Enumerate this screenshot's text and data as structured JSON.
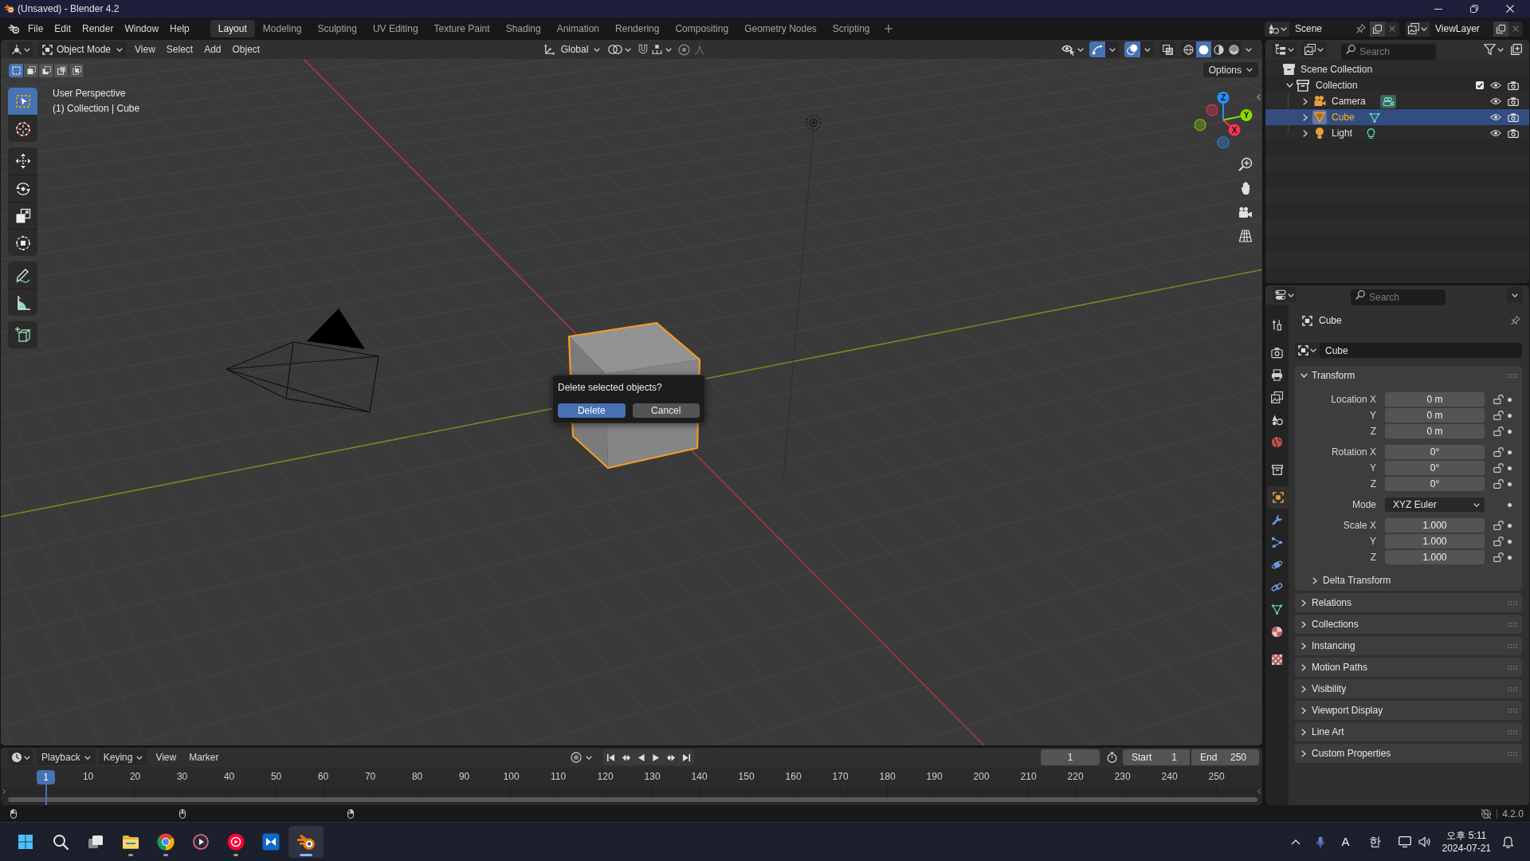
{
  "window": {
    "title": "(Unsaved) - Blender 4.2"
  },
  "menu": [
    "File",
    "Edit",
    "Render",
    "Window",
    "Help"
  ],
  "workspace_tabs": [
    {
      "label": "Layout",
      "selected": true
    },
    {
      "label": "Modeling",
      "selected": false
    },
    {
      "label": "Sculpting",
      "selected": false
    },
    {
      "label": "UV Editing",
      "selected": false
    },
    {
      "label": "Texture Paint",
      "selected": false
    },
    {
      "label": "Shading",
      "selected": false
    },
    {
      "label": "Animation",
      "selected": false
    },
    {
      "label": "Rendering",
      "selected": false
    },
    {
      "label": "Compositing",
      "selected": false
    },
    {
      "label": "Geometry Nodes",
      "selected": false
    },
    {
      "label": "Scripting",
      "selected": false
    }
  ],
  "scene_selector": {
    "value": "Scene"
  },
  "view_layer_selector": {
    "value": "ViewLayer"
  },
  "viewport": {
    "mode": "Object Mode",
    "menus": [
      "View",
      "Select",
      "Add",
      "Object"
    ],
    "orientation": "Global",
    "gizmos_on": true,
    "overlays_on": true,
    "xray_on": false,
    "shading_modes": [
      {
        "kind": "wireframe",
        "selected": false
      },
      {
        "kind": "solid",
        "selected": true
      },
      {
        "kind": "material",
        "selected": false
      },
      {
        "kind": "rendered",
        "selected": false
      }
    ],
    "select_modes": [
      {
        "kind": "set",
        "selected": true
      },
      {
        "kind": "extend",
        "selected": false
      },
      {
        "kind": "subtract",
        "selected": false
      },
      {
        "kind": "invert",
        "selected": false
      },
      {
        "kind": "intersect",
        "selected": false
      }
    ],
    "options": "Options",
    "info": [
      "User Perspective",
      "(1) Collection | Cube"
    ],
    "tool_groups": [
      [
        {
          "kind": "select_box",
          "selected": true
        },
        {
          "kind": "cursor",
          "selected": false
        }
      ],
      [
        {
          "kind": "move",
          "selected": false
        },
        {
          "kind": "rotate",
          "selected": false
        },
        {
          "kind": "scale",
          "selected": false
        },
        {
          "kind": "transform",
          "selected": false
        }
      ],
      [
        {
          "kind": "annotate",
          "selected": false
        },
        {
          "kind": "measure",
          "selected": false
        }
      ],
      [
        {
          "kind": "add_cube",
          "selected": false
        }
      ]
    ],
    "gizmo_axes": [
      {
        "label": "X",
        "color": "#ff3352"
      },
      {
        "label": "Y",
        "color": "#8bdc00"
      },
      {
        "label": "Z",
        "color": "#2890ff"
      }
    ],
    "dialog": {
      "message": "Delete selected objects?",
      "buttons": [
        {
          "label": "Delete",
          "selected": true
        },
        {
          "label": "Cancel",
          "selected": false
        }
      ]
    }
  },
  "outliner": {
    "search_placeholder": "Search",
    "root": "Scene Collection",
    "collections": [
      {
        "label": "Collection",
        "expanded": true,
        "checked": true,
        "children": [
          {
            "label": "Camera",
            "kind": "camera",
            "selected": false,
            "expanded": false
          },
          {
            "label": "Cube",
            "kind": "mesh",
            "selected": true,
            "expanded": false
          },
          {
            "label": "Light",
            "kind": "light",
            "selected": false,
            "expanded": false
          }
        ]
      }
    ]
  },
  "properties": {
    "search_placeholder": "Search",
    "tab_groups": [
      [
        {
          "kind": "tool",
          "selected": false
        }
      ],
      [
        {
          "kind": "render",
          "selected": false
        },
        {
          "kind": "output",
          "selected": false
        },
        {
          "kind": "view_layer",
          "selected": false
        },
        {
          "kind": "scene",
          "selected": false
        },
        {
          "kind": "world",
          "selected": false
        }
      ],
      [
        {
          "kind": "collection",
          "selected": false
        }
      ],
      [
        {
          "kind": "object",
          "selected": true
        },
        {
          "kind": "modifiers",
          "selected": false
        },
        {
          "kind": "particles",
          "selected": false
        },
        {
          "kind": "physics",
          "selected": false
        },
        {
          "kind": "constraints",
          "selected": false
        },
        {
          "kind": "data",
          "selected": false
        },
        {
          "kind": "material",
          "selected": false
        }
      ],
      [
        {
          "kind": "texture",
          "selected": false
        }
      ]
    ],
    "object_name": "Cube",
    "datablock": "Cube",
    "transform": {
      "label": "Transform",
      "expanded": true,
      "groups": [
        [
          {
            "label": "Location X",
            "kind": "number",
            "value": "0 m"
          },
          {
            "label": "Y",
            "kind": "number",
            "value": "0 m"
          },
          {
            "label": "Z",
            "kind": "number",
            "value": "0 m"
          }
        ],
        [
          {
            "label": "Rotation X",
            "kind": "number",
            "value": "0°"
          },
          {
            "label": "Y",
            "kind": "number",
            "value": "0°"
          },
          {
            "label": "Z",
            "kind": "number",
            "value": "0°"
          }
        ],
        [
          {
            "label": "Mode",
            "kind": "dropdown",
            "value": "XYZ Euler"
          }
        ],
        [
          {
            "label": "Scale X",
            "kind": "number",
            "value": "1.000"
          },
          {
            "label": "Y",
            "kind": "number",
            "value": "1.000"
          },
          {
            "label": "Z",
            "kind": "number",
            "value": "1.000"
          }
        ]
      ],
      "subpanel": {
        "label": "Delta Transform",
        "expanded": false
      }
    },
    "panels": [
      {
        "label": "Relations",
        "expanded": false
      },
      {
        "label": "Collections",
        "expanded": false
      },
      {
        "label": "Instancing",
        "expanded": false
      },
      {
        "label": "Motion Paths",
        "expanded": false
      },
      {
        "label": "Visibility",
        "expanded": false
      },
      {
        "label": "Viewport Display",
        "expanded": false
      },
      {
        "label": "Line Art",
        "expanded": false
      },
      {
        "label": "Custom Properties",
        "expanded": false
      }
    ]
  },
  "timeline": {
    "menus": [
      {
        "label": "Playback",
        "kind": "popover"
      },
      {
        "label": "Keying",
        "kind": "popover"
      },
      {
        "label": "View",
        "kind": "menu"
      },
      {
        "label": "Marker",
        "kind": "menu"
      }
    ],
    "current_frame": "1",
    "start_label": "Start",
    "start": "1",
    "end_label": "End",
    "end": "250",
    "playhead": "1",
    "ruler": [
      "10",
      "20",
      "30",
      "40",
      "50",
      "60",
      "70",
      "80",
      "90",
      "100",
      "110",
      "120",
      "130",
      "140",
      "150",
      "160",
      "170",
      "180",
      "190",
      "200",
      "210",
      "220",
      "230",
      "240",
      "250"
    ]
  },
  "status_bar": {
    "version": "4.2.0"
  },
  "taskbar": {
    "apps": [
      {
        "kind": "explorer",
        "running": true,
        "selected": false
      },
      {
        "kind": "chrome",
        "running": true,
        "selected": false
      },
      {
        "kind": "media_player",
        "running": false,
        "selected": false
      },
      {
        "kind": "music",
        "running": true,
        "selected": false
      },
      {
        "kind": "bowtie_app",
        "running": false,
        "selected": false
      },
      {
        "kind": "blender",
        "running": true,
        "selected": true
      }
    ],
    "input_mode": "A",
    "ime": "한",
    "time": "오후 5:11",
    "date": "2024-07-21"
  }
}
